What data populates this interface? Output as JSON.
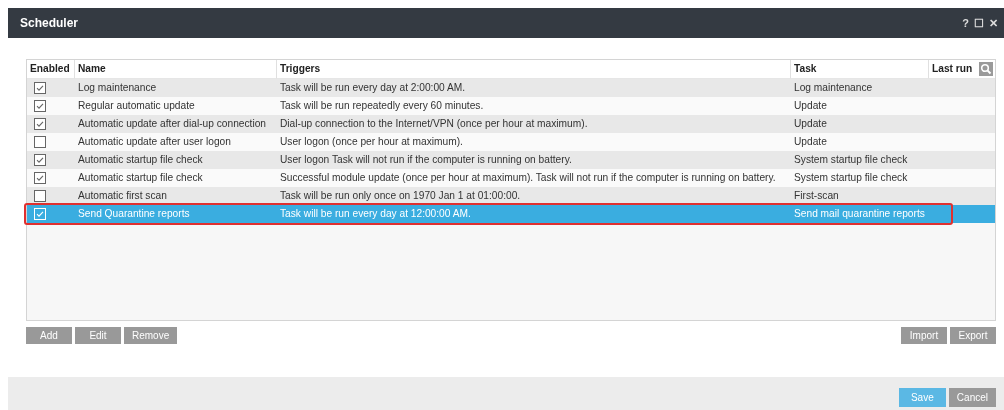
{
  "window": {
    "title": "Scheduler",
    "controls": [
      "?",
      "☐",
      "✕"
    ]
  },
  "table": {
    "columns": [
      "Enabled",
      "Name",
      "Triggers",
      "Task",
      "Last run"
    ],
    "rows": [
      {
        "enabled": true,
        "name": "Log maintenance",
        "triggers": "Task will be run every day at 2:00:00 AM.",
        "task": "Log maintenance",
        "selected": false,
        "outlined": false
      },
      {
        "enabled": true,
        "name": "Regular automatic update",
        "triggers": "Task will be run repeatedly every 60 minutes.",
        "task": "Update",
        "selected": false,
        "outlined": false
      },
      {
        "enabled": true,
        "name": "Automatic update after dial-up connection",
        "triggers": "Dial-up connection to the Internet/VPN (once per hour at maximum).",
        "task": "Update",
        "selected": false,
        "outlined": false
      },
      {
        "enabled": false,
        "name": "Automatic update after user logon",
        "triggers": "User logon (once per hour at maximum).",
        "task": "Update",
        "selected": false,
        "outlined": false
      },
      {
        "enabled": true,
        "name": "Automatic startup file check",
        "triggers": "User logon Task will not run if the computer is running on battery.",
        "task": "System startup file check",
        "selected": false,
        "outlined": false
      },
      {
        "enabled": true,
        "name": "Automatic startup file check",
        "triggers": "Successful module update (once per hour at maximum). Task will not run if the computer is running on battery.",
        "task": "System startup file check",
        "selected": false,
        "outlined": false
      },
      {
        "enabled": false,
        "name": "Automatic first scan",
        "triggers": "Task will be run only once on 1970 Jan 1 at 01:00:00.",
        "task": "First-scan",
        "selected": false,
        "outlined": false
      },
      {
        "enabled": true,
        "name": "Send Quarantine reports",
        "triggers": "Task will be run every day at 12:00:00 AM.",
        "task": "Send mail quarantine reports",
        "selected": true,
        "outlined": true
      }
    ]
  },
  "table_buttons_left": [
    "Add",
    "Edit",
    "Remove"
  ],
  "table_buttons_right": [
    "Import",
    "Export"
  ],
  "footer_buttons": [
    {
      "label": "Save",
      "kind": "primary"
    },
    {
      "label": "Cancel",
      "kind": "secondary"
    }
  ]
}
